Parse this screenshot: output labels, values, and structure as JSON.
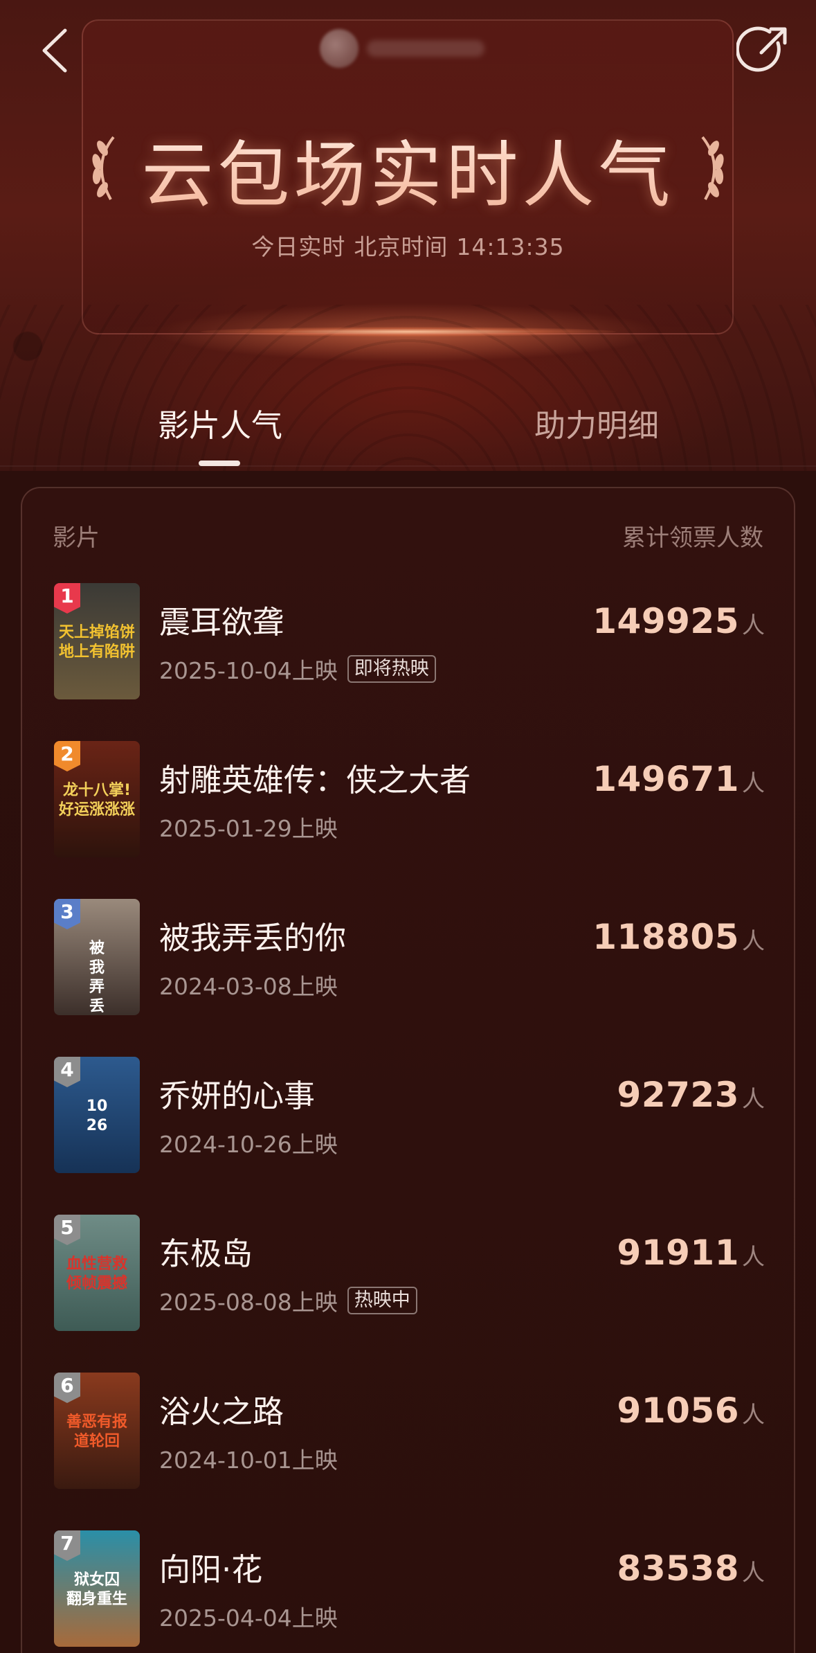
{
  "header": {
    "title": "云包场实时人气",
    "subtitle_prefix": "今日实时",
    "subtitle_tz": "北京时间",
    "time": "14:13:35",
    "back_icon": "chevron-left-icon",
    "share_icon": "share-icon"
  },
  "tabs": [
    {
      "label": "影片人气",
      "active": true
    },
    {
      "label": "助力明细",
      "active": false
    }
  ],
  "table": {
    "col_left": "影片",
    "col_right": "累计领票人数",
    "unit": "人"
  },
  "movies": [
    {
      "rank": "1",
      "title": "震耳欲聋",
      "date": "2025-10-04上映",
      "tag": "即将热映",
      "count": "149925",
      "rank_color": "#e8394c",
      "poster_colors": [
        "#3b3a36",
        "#6b5a3c"
      ],
      "poster_text": "天上掉馅饼\n地上有陷阱",
      "poster_text_color": "#f2c230"
    },
    {
      "rank": "2",
      "title": "射雕英雄传：侠之大者",
      "date": "2025-01-29上映",
      "tag": "",
      "count": "149671",
      "rank_color": "#f08a2c",
      "poster_colors": [
        "#6a2416",
        "#2e130c"
      ],
      "poster_text": "龙十八掌!\n好运涨涨涨",
      "poster_text_color": "#f3d05a"
    },
    {
      "rank": "3",
      "title": "被我弄丢的你",
      "date": "2024-03-08上映",
      "tag": "",
      "count": "118805",
      "rank_color": "#5a7ec8",
      "poster_colors": [
        "#9a8a7c",
        "#3c2f2a"
      ],
      "poster_text": "被\n我\n弄\n丢",
      "poster_text_color": "#ffffff"
    },
    {
      "rank": "4",
      "title": "乔妍的心事",
      "date": "2024-10-26上映",
      "tag": "",
      "count": "92723",
      "rank_color": "#8d8d8d",
      "poster_colors": [
        "#2d5a8e",
        "#163256"
      ],
      "poster_text": "10\n26",
      "poster_text_color": "#ffffff"
    },
    {
      "rank": "5",
      "title": "东极岛",
      "date": "2025-08-08上映",
      "tag": "热映中",
      "count": "91911",
      "rank_color": "#8d8d8d",
      "poster_colors": [
        "#6f8c86",
        "#3e5b55"
      ],
      "poster_text": "血性营救\n倾帧震撼",
      "poster_text_color": "#d8342c"
    },
    {
      "rank": "6",
      "title": "浴火之路",
      "date": "2024-10-01上映",
      "tag": "",
      "count": "91056",
      "rank_color": "#8d8d8d",
      "poster_colors": [
        "#8a3a1e",
        "#3a1a10"
      ],
      "poster_text": "善恶有报\n道轮回",
      "poster_text_color": "#f05a2a"
    },
    {
      "rank": "7",
      "title": "向阳·花",
      "date": "2025-04-04上映",
      "tag": "",
      "count": "83538",
      "rank_color": "#8d8d8d",
      "poster_colors": [
        "#2a8fa8",
        "#a86a3a"
      ],
      "poster_text": "狱女囚\n翻身重生",
      "poster_text_color": "#ffffff"
    }
  ]
}
